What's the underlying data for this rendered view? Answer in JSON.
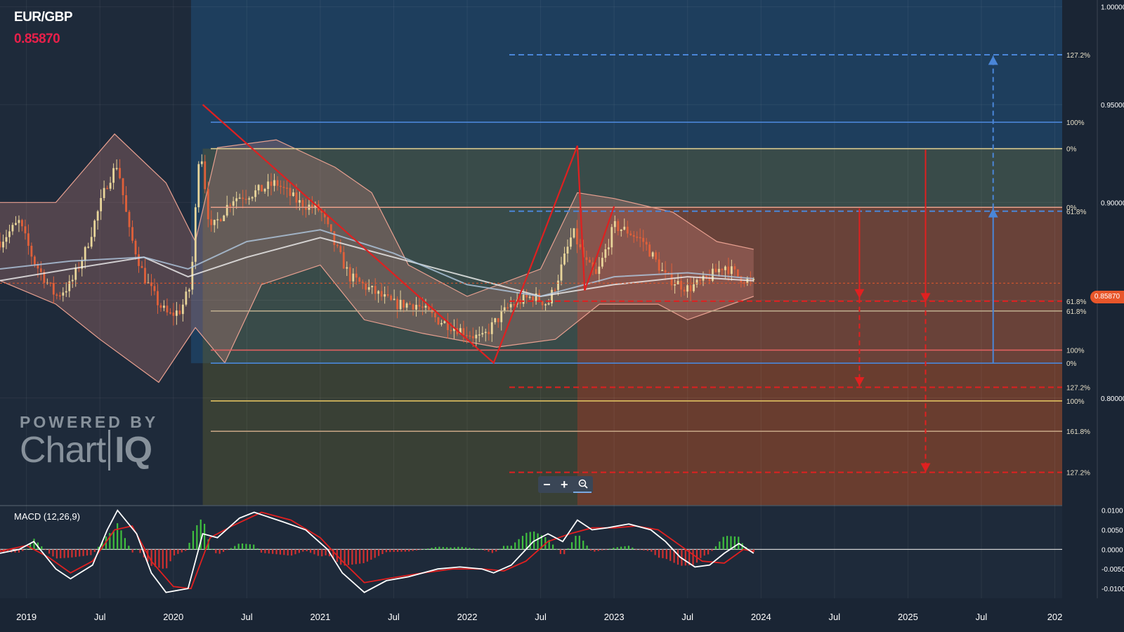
{
  "header": {
    "symbol": "EUR/GBP",
    "price": "0.85870"
  },
  "macd": {
    "title": "MACD (12,26,9)"
  },
  "branding": {
    "powered_by": "POWERED BY",
    "name_left": "Chart",
    "name_right": "IQ"
  },
  "zoom": {
    "minus": "−",
    "plus": "+",
    "zoom_icon": "magnifier-icon"
  },
  "price_tag": "0.85870",
  "colors": {
    "background": "#1e2a3a",
    "price": "#e8204a",
    "up_candle": "#e8d59a",
    "down_candle": "#e0603a",
    "macd_line": "#ffffff",
    "signal_line": "#e02020",
    "hist_up": "#3fbf3f",
    "hist_down": "#d03030",
    "blue_level": "#4a86d8",
    "red_level": "#e02020"
  },
  "chart_data": [
    {
      "type": "line",
      "name": "price-panel",
      "x_axis_labels": [
        {
          "label": "2019",
          "x": 2019.0
        },
        {
          "label": "Jul",
          "x": 2019.5
        },
        {
          "label": "2020",
          "x": 2020.0
        },
        {
          "label": "Jul",
          "x": 2020.5
        },
        {
          "label": "2021",
          "x": 2021.0
        },
        {
          "label": "Jul",
          "x": 2021.5
        },
        {
          "label": "2022",
          "x": 2022.0
        },
        {
          "label": "Jul",
          "x": 2022.5
        },
        {
          "label": "2023",
          "x": 2023.0
        },
        {
          "label": "Jul",
          "x": 2023.5
        },
        {
          "label": "2024",
          "x": 2024.0
        },
        {
          "label": "Jul",
          "x": 2024.5
        },
        {
          "label": "2025",
          "x": 2025.0
        },
        {
          "label": "Jul",
          "x": 2025.5
        },
        {
          "label": "202",
          "x": 2026.0
        }
      ],
      "xlim": [
        2018.82,
        2026.05
      ],
      "ylim": [
        0.745,
        1.0035
      ],
      "y_ticks": [
        {
          "label": "1.00000",
          "value": 1.0
        },
        {
          "label": "0.95000",
          "value": 0.95
        },
        {
          "label": "0.90000",
          "value": 0.9
        },
        {
          "label": "0.85000",
          "value": 0.85
        },
        {
          "label": "0.80000",
          "value": 0.8
        }
      ],
      "last_price": 0.8587,
      "close_path": [
        [
          2018.82,
          0.88
        ],
        [
          2018.95,
          0.89
        ],
        [
          2019.05,
          0.87
        ],
        [
          2019.2,
          0.852
        ],
        [
          2019.3,
          0.858
        ],
        [
          2019.4,
          0.875
        ],
        [
          2019.55,
          0.91
        ],
        [
          2019.62,
          0.92
        ],
        [
          2019.7,
          0.885
        ],
        [
          2019.8,
          0.862
        ],
        [
          2019.9,
          0.848
        ],
        [
          2019.97,
          0.842
        ],
        [
          2020.05,
          0.845
        ],
        [
          2020.12,
          0.858
        ],
        [
          2020.18,
          0.932
        ],
        [
          2020.25,
          0.885
        ],
        [
          2020.4,
          0.902
        ],
        [
          2020.55,
          0.905
        ],
        [
          2020.7,
          0.91
        ],
        [
          2020.85,
          0.9
        ],
        [
          2021.0,
          0.896
        ],
        [
          2021.1,
          0.878
        ],
        [
          2021.2,
          0.862
        ],
        [
          2021.35,
          0.855
        ],
        [
          2021.5,
          0.848
        ],
        [
          2021.65,
          0.848
        ],
        [
          2021.8,
          0.84
        ],
        [
          2021.95,
          0.835
        ],
        [
          2022.1,
          0.83
        ],
        [
          2022.18,
          0.838
        ],
        [
          2022.3,
          0.848
        ],
        [
          2022.45,
          0.852
        ],
        [
          2022.55,
          0.848
        ],
        [
          2022.62,
          0.862
        ],
        [
          2022.72,
          0.885
        ],
        [
          2022.8,
          0.87
        ],
        [
          2022.88,
          0.862
        ],
        [
          2023.0,
          0.888
        ],
        [
          2023.1,
          0.885
        ],
        [
          2023.2,
          0.88
        ],
        [
          2023.35,
          0.862
        ],
        [
          2023.5,
          0.856
        ],
        [
          2023.62,
          0.86
        ],
        [
          2023.75,
          0.868
        ],
        [
          2023.85,
          0.862
        ],
        [
          2023.95,
          0.8587
        ]
      ],
      "moving_averages": [
        {
          "name": "",
          "color": "#f0f0f0",
          "points": [
            [
              2018.82,
              0.86
            ],
            [
              2019.3,
              0.866
            ],
            [
              2019.8,
              0.872
            ],
            [
              2020.1,
              0.862
            ],
            [
              2020.5,
              0.872
            ],
            [
              2021.0,
              0.882
            ],
            [
              2021.5,
              0.872
            ],
            [
              2022.0,
              0.862
            ],
            [
              2022.5,
              0.852
            ],
            [
              2023.0,
              0.858
            ],
            [
              2023.5,
              0.862
            ],
            [
              2023.95,
              0.86
            ]
          ]
        },
        {
          "name": "",
          "color": "#b0c8e0",
          "points": [
            [
              2018.82,
              0.866
            ],
            [
              2019.3,
              0.87
            ],
            [
              2019.8,
              0.872
            ],
            [
              2020.1,
              0.866
            ],
            [
              2020.5,
              0.88
            ],
            [
              2021.0,
              0.886
            ],
            [
              2021.5,
              0.874
            ],
            [
              2022.0,
              0.858
            ],
            [
              2022.5,
              0.852
            ],
            [
              2023.0,
              0.862
            ],
            [
              2023.5,
              0.864
            ],
            [
              2023.95,
              0.861
            ]
          ]
        }
      ],
      "bollinger": {
        "upper": [
          [
            2018.82,
            0.9
          ],
          [
            2019.2,
            0.9
          ],
          [
            2019.6,
            0.935
          ],
          [
            2019.95,
            0.91
          ],
          [
            2020.15,
            0.88
          ],
          [
            2020.3,
            0.928
          ],
          [
            2020.7,
            0.932
          ],
          [
            2021.1,
            0.918
          ],
          [
            2021.35,
            0.905
          ],
          [
            2021.6,
            0.868
          ],
          [
            2022.0,
            0.852
          ],
          [
            2022.5,
            0.866
          ],
          [
            2022.75,
            0.905
          ],
          [
            2023.0,
            0.902
          ],
          [
            2023.4,
            0.895
          ],
          [
            2023.7,
            0.88
          ],
          [
            2023.95,
            0.876
          ]
        ],
        "lower": [
          [
            2018.82,
            0.86
          ],
          [
            2019.2,
            0.848
          ],
          [
            2019.5,
            0.83
          ],
          [
            2019.9,
            0.808
          ],
          [
            2020.15,
            0.836
          ],
          [
            2020.35,
            0.818
          ],
          [
            2020.6,
            0.858
          ],
          [
            2021.0,
            0.868
          ],
          [
            2021.3,
            0.84
          ],
          [
            2021.7,
            0.833
          ],
          [
            2022.2,
            0.826
          ],
          [
            2022.6,
            0.83
          ],
          [
            2022.9,
            0.848
          ],
          [
            2023.3,
            0.848
          ],
          [
            2023.5,
            0.84
          ],
          [
            2023.95,
            0.852
          ]
        ]
      },
      "levels": [
        {
          "label": "127.2%",
          "value": 0.9755,
          "color": "#4a86d8",
          "dashed": true
        },
        {
          "label": "100%",
          "value": 0.941,
          "color": "#4a86d8",
          "dashed": false
        },
        {
          "label": "0%",
          "value": 0.9275,
          "color": "#d8c890",
          "dashed": false
        },
        {
          "label": "0%",
          "value": 0.8975,
          "color": "#e8a08a",
          "dashed": false
        },
        {
          "label": "61.8%",
          "value": 0.8955,
          "color": "#4a86d8",
          "dashed": true
        },
        {
          "label": "61.8%",
          "value": 0.8495,
          "color": "#e02020",
          "dashed": true
        },
        {
          "label": "61.8%",
          "value": 0.8445,
          "color": "#c0b090",
          "dashed": false
        },
        {
          "label": "100%",
          "value": 0.8245,
          "color": "#e06060",
          "dashed": false
        },
        {
          "label": "0%",
          "value": 0.8178,
          "color": "#4a86d8",
          "dashed": false
        },
        {
          "label": "127.2%",
          "value": 0.8055,
          "color": "#e02020",
          "dashed": true
        },
        {
          "label": "100%",
          "value": 0.7985,
          "color": "#e0c060",
          "dashed": false
        },
        {
          "label": "161.8%",
          "value": 0.783,
          "color": "#c0a080",
          "dashed": false
        },
        {
          "label": "127.2%",
          "value": 0.762,
          "color": "#e02020",
          "dashed": true
        }
      ],
      "zigzag": [
        [
          2020.2,
          0.95
        ],
        [
          2022.18,
          0.818
        ],
        [
          2022.75,
          0.929
        ],
        [
          2022.8,
          0.855
        ],
        [
          2022.88,
          0.872
        ],
        [
          2023.0,
          0.898
        ]
      ],
      "annotations": [
        {
          "kind": "blue-arrow-up",
          "x": 2025.58,
          "from": 0.818,
          "to": 0.897
        },
        {
          "kind": "blue-arrow-up-dashed",
          "x": 2025.58,
          "from": 0.897,
          "to": 0.975
        },
        {
          "kind": "red-arrow-down",
          "x": 2024.67,
          "from": 0.897,
          "to": 0.851
        },
        {
          "kind": "red-arrow-down-dashed",
          "x": 2024.67,
          "from": 0.851,
          "to": 0.806
        },
        {
          "kind": "red-arrow-down",
          "x": 2025.12,
          "from": 0.927,
          "to": 0.849
        },
        {
          "kind": "red-arrow-down-dashed",
          "x": 2025.12,
          "from": 0.849,
          "to": 0.762
        }
      ]
    },
    {
      "type": "bar",
      "name": "macd-panel",
      "title": "MACD (12,26,9)",
      "ylim": [
        -0.0125,
        0.0112
      ],
      "y_ticks": [
        {
          "label": "0.0100",
          "value": 0.01
        },
        {
          "label": "0.0050",
          "value": 0.005
        },
        {
          "label": "0.0000",
          "value": 0.0
        },
        {
          "label": "-0.0050",
          "value": -0.005
        },
        {
          "label": "-0.0100",
          "value": -0.01
        }
      ],
      "macd_line": [
        [
          2018.82,
          -0.001
        ],
        [
          2018.95,
          0.0
        ],
        [
          2019.05,
          0.002
        ],
        [
          2019.2,
          -0.005
        ],
        [
          2019.3,
          -0.0075
        ],
        [
          2019.45,
          -0.004
        ],
        [
          2019.55,
          0.005
        ],
        [
          2019.62,
          0.01
        ],
        [
          2019.75,
          0.004
        ],
        [
          2019.85,
          -0.006
        ],
        [
          2019.95,
          -0.011
        ],
        [
          2020.1,
          -0.01
        ],
        [
          2020.2,
          0.004
        ],
        [
          2020.3,
          0.003
        ],
        [
          2020.45,
          0.008
        ],
        [
          2020.55,
          0.0095
        ],
        [
          2020.75,
          0.007
        ],
        [
          2020.9,
          0.005
        ],
        [
          2021.05,
          0.0
        ],
        [
          2021.15,
          -0.006
        ],
        [
          2021.3,
          -0.011
        ],
        [
          2021.45,
          -0.008
        ],
        [
          2021.6,
          -0.007
        ],
        [
          2021.8,
          -0.005
        ],
        [
          2021.95,
          -0.0045
        ],
        [
          2022.1,
          -0.005
        ],
        [
          2022.18,
          -0.006
        ],
        [
          2022.3,
          -0.004
        ],
        [
          2022.45,
          0.002
        ],
        [
          2022.55,
          0.004
        ],
        [
          2022.65,
          0.002
        ],
        [
          2022.75,
          0.0075
        ],
        [
          2022.85,
          0.005
        ],
        [
          2022.95,
          0.0055
        ],
        [
          2023.1,
          0.0065
        ],
        [
          2023.25,
          0.005
        ],
        [
          2023.35,
          0.002
        ],
        [
          2023.45,
          -0.002
        ],
        [
          2023.55,
          -0.0045
        ],
        [
          2023.65,
          -0.004
        ],
        [
          2023.75,
          -0.001
        ],
        [
          2023.85,
          0.0015
        ],
        [
          2023.95,
          -0.001
        ]
      ],
      "signal_line": [
        [
          2018.82,
          -0.0005
        ],
        [
          2019.0,
          0.001
        ],
        [
          2019.15,
          -0.002
        ],
        [
          2019.3,
          -0.006
        ],
        [
          2019.45,
          -0.003
        ],
        [
          2019.6,
          0.005
        ],
        [
          2019.72,
          0.006
        ],
        [
          2019.85,
          -0.003
        ],
        [
          2020.0,
          -0.0095
        ],
        [
          2020.12,
          -0.01
        ],
        [
          2020.25,
          0.003
        ],
        [
          2020.4,
          0.006
        ],
        [
          2020.6,
          0.0095
        ],
        [
          2020.8,
          0.0075
        ],
        [
          2021.0,
          0.003
        ],
        [
          2021.15,
          -0.003
        ],
        [
          2021.3,
          -0.0085
        ],
        [
          2021.45,
          -0.0075
        ],
        [
          2021.7,
          -0.006
        ],
        [
          2021.9,
          -0.005
        ],
        [
          2022.1,
          -0.005
        ],
        [
          2022.25,
          -0.0055
        ],
        [
          2022.4,
          -0.003
        ],
        [
          2022.55,
          0.002
        ],
        [
          2022.7,
          0.004
        ],
        [
          2022.85,
          0.0055
        ],
        [
          2023.0,
          0.0055
        ],
        [
          2023.15,
          0.006
        ],
        [
          2023.3,
          0.005
        ],
        [
          2023.45,
          0.001
        ],
        [
          2023.6,
          -0.003
        ],
        [
          2023.75,
          -0.0035
        ],
        [
          2023.88,
          0.0
        ],
        [
          2023.95,
          -0.0005
        ]
      ]
    }
  ]
}
